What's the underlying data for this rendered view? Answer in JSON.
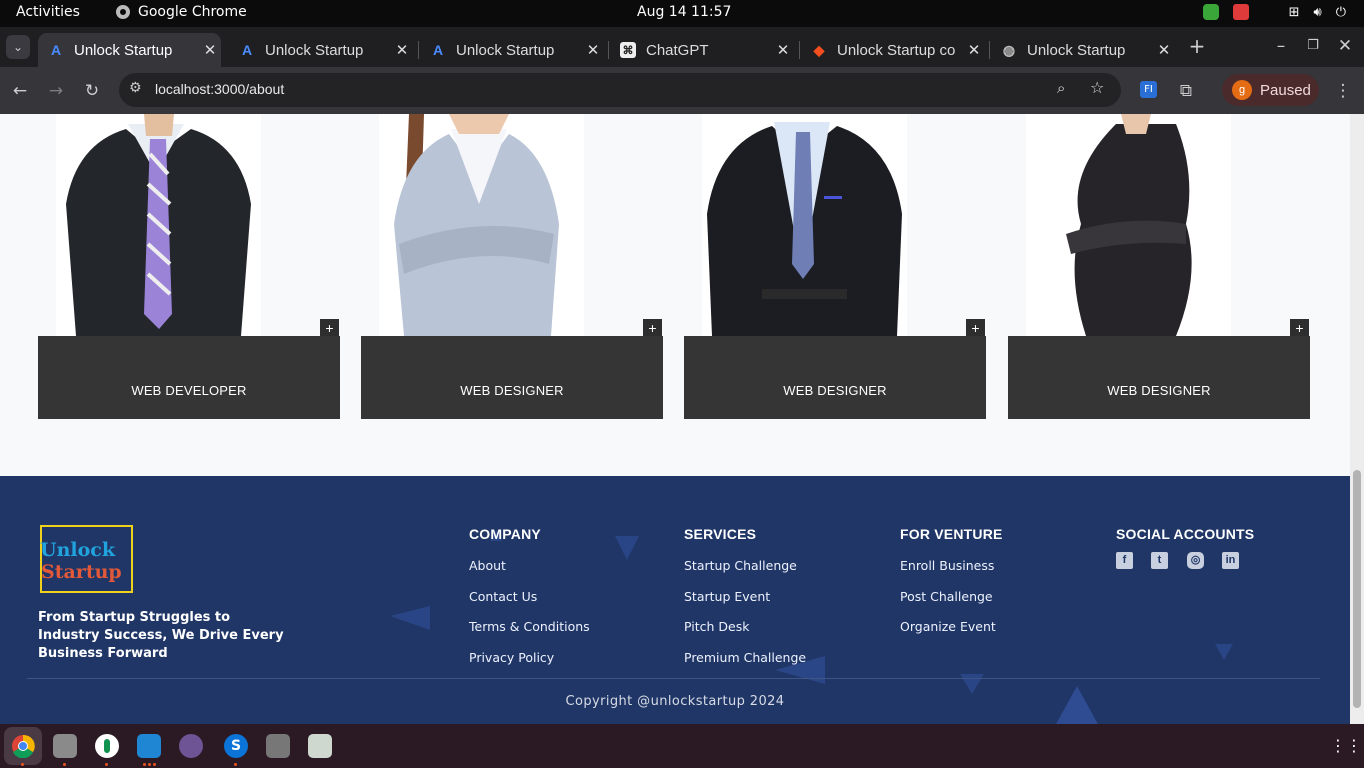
{
  "system": {
    "activities": "Activities",
    "app_name": "Google Chrome",
    "clock": "Aug 14  11:57"
  },
  "browser": {
    "tabs": [
      {
        "title": "Unlock Startup",
        "favicon": "unlock-startup-icon",
        "active": true
      },
      {
        "title": "Unlock Startup",
        "favicon": "unlock-startup-icon",
        "active": false
      },
      {
        "title": "Unlock Startup",
        "favicon": "unlock-startup-icon",
        "active": false
      },
      {
        "title": "ChatGPT",
        "favicon": "chatgpt-icon",
        "active": false
      },
      {
        "title": "Unlock Startup co",
        "favicon": "figma-icon",
        "active": false
      },
      {
        "title": "Unlock Startup",
        "favicon": "globe-icon",
        "active": false
      }
    ],
    "url": "localhost:3000/about",
    "profile_initial": "g",
    "profile_status": "Paused"
  },
  "team": [
    {
      "role": "WEB DEVELOPER",
      "plus": "+"
    },
    {
      "role": "WEB DESIGNER",
      "plus": "+"
    },
    {
      "role": "WEB DESIGNER",
      "plus": "+"
    },
    {
      "role": "WEB DESIGNER",
      "plus": "+"
    }
  ],
  "footer": {
    "logo_line1": "Unlock",
    "logo_line2": "Startup",
    "tagline": "From Startup Struggles to Industry Success, We Drive Every Business Forward",
    "company": {
      "title": "COMPANY",
      "links": [
        "About",
        "Contact Us",
        "Terms & Conditions",
        "Privacy Policy"
      ]
    },
    "services": {
      "title": "SERVICES",
      "links": [
        "Startup Challenge",
        "Startup Event",
        "Pitch Desk",
        "Premium Challenge"
      ]
    },
    "venture": {
      "title": "FOR VENTURE",
      "links": [
        "Enroll Business",
        "Post Challenge",
        "Organize Event"
      ]
    },
    "social": {
      "title": "SOCIAL ACCOUNTS",
      "icons": [
        "facebook-icon",
        "twitter-icon",
        "instagram-icon",
        "linkedin-icon"
      ]
    },
    "copyright": "Copyright @unlockstartup 2024"
  },
  "colors": {
    "footer_bg": "#1f3666",
    "card_bg": "#353535",
    "logo_border": "#f0d11c",
    "logo_blue": "#21a4de",
    "logo_red": "#e2593a"
  }
}
